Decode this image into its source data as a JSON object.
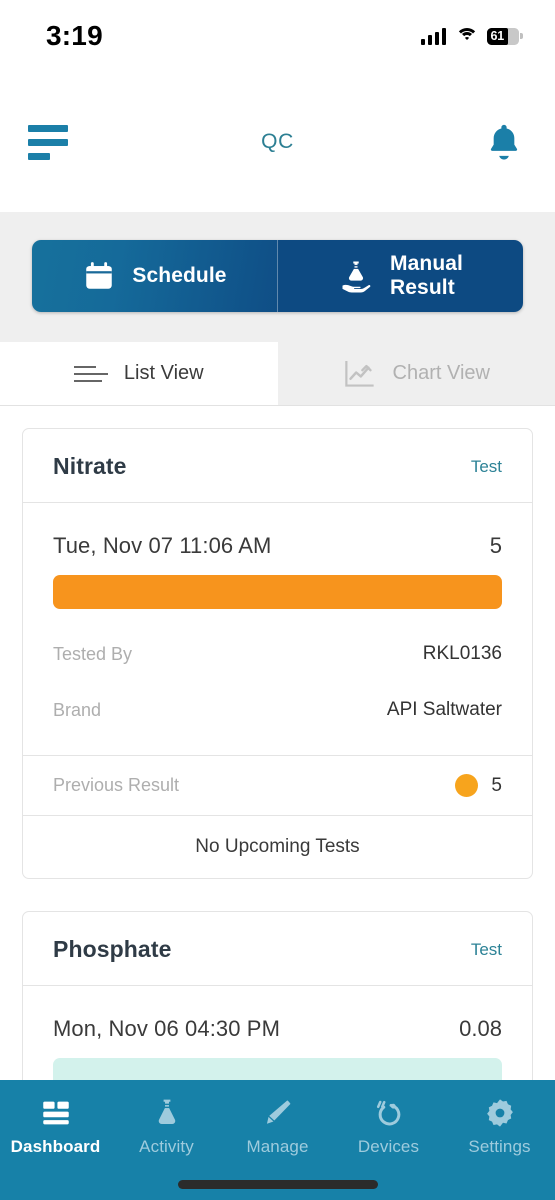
{
  "status_bar": {
    "time": "3:19",
    "battery_level": "61",
    "signal_icon": "cellular-signal-icon",
    "wifi_icon": "wifi-icon",
    "battery_icon": "battery-icon"
  },
  "header": {
    "menu_icon": "hamburger-menu-icon",
    "title": "QC",
    "notification_icon": "bell-icon"
  },
  "action_strip": {
    "schedule": {
      "label": "Schedule",
      "icon": "calendar-icon"
    },
    "manual_result": {
      "label": "Manual\nResult",
      "line1": "Manual",
      "line2": "Result",
      "icon": "flask-in-hand-icon"
    },
    "gradient_start": "#16719c",
    "gradient_end": "#0f4e86",
    "manual_bg": "#0d4a82"
  },
  "view_tabs": [
    {
      "label": "List View",
      "icon": "list-lines-icon",
      "active": true
    },
    {
      "label": "Chart View",
      "icon": "line-chart-icon",
      "active": false
    }
  ],
  "cards": [
    {
      "title": "Nitrate",
      "test_label": "Test",
      "reading": {
        "date": "Tue, Nov 07 11:06 AM",
        "value": "5"
      },
      "bar_color": "#f7941d",
      "details": [
        {
          "key": "Tested By",
          "value": "RKL0136"
        },
        {
          "key": "Brand",
          "value": "API Saltwater"
        }
      ],
      "previous": {
        "label": "Previous Result",
        "value": "5",
        "dot_color": "#f7a41d"
      },
      "upcoming": "No Upcoming Tests"
    },
    {
      "title": "Phosphate",
      "test_label": "Test",
      "reading": {
        "date": "Mon, Nov 06 04:30 PM",
        "value": "0.08"
      },
      "bar_color": "#d3f2ec"
    }
  ],
  "bottom_nav": {
    "background": "#1781a8",
    "items": [
      {
        "label": "Dashboard",
        "icon": "dashboard-grid-icon",
        "active": true
      },
      {
        "label": "Activity",
        "icon": "flask-icon",
        "active": false
      },
      {
        "label": "Manage",
        "icon": "pencil-icon",
        "active": false
      },
      {
        "label": "Devices",
        "icon": "device-signal-icon",
        "active": false
      },
      {
        "label": "Settings",
        "icon": "gear-icon",
        "active": false
      }
    ]
  }
}
